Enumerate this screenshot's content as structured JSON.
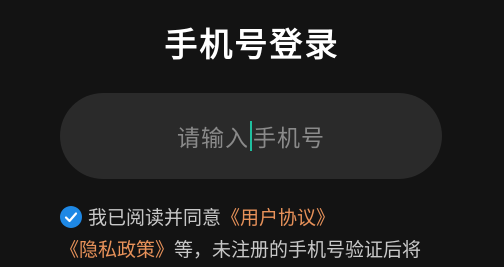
{
  "page": {
    "title": "手机号登录"
  },
  "phone_input": {
    "placeholder_before_caret": "请输入",
    "placeholder_after_caret": "手机号"
  },
  "agreement": {
    "prefix": "我已阅读并同意",
    "user_agreement_link": "《用户协议》",
    "privacy_policy_link": "《隐私政策》",
    "suffix": "等，未注册的手机号验证后将"
  },
  "colors": {
    "accent_link": "#e8925a",
    "checkbox": "#1e88e5",
    "caret": "#1fbf9f",
    "background": "#131313",
    "input_background": "#2a2a2a"
  }
}
